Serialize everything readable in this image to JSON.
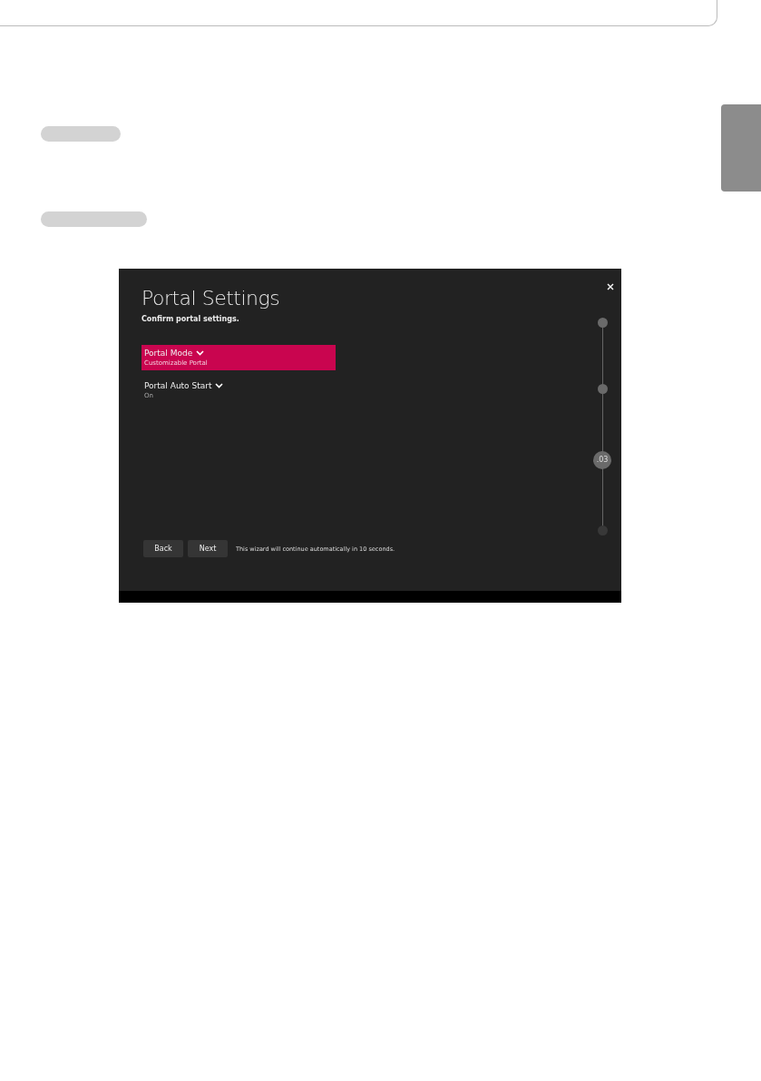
{
  "screen": {
    "title": "Portal Settings",
    "subtitle": "Confirm portal settings.",
    "settings": [
      {
        "label": "Portal Mode",
        "value": "Customizable Portal",
        "selected": true
      },
      {
        "label": "Portal Auto Start",
        "value": "On",
        "selected": false
      }
    ],
    "steps": [
      {
        "reached": true,
        "selected": false
      },
      {
        "reached": true,
        "selected": false
      },
      {
        "reached": true,
        "selected": true,
        "label": ".03"
      },
      {
        "reached": false,
        "selected": false
      }
    ],
    "buttons": [
      "Back",
      "Next"
    ],
    "message": "This wizard will continue automatically in 10 seconds."
  }
}
